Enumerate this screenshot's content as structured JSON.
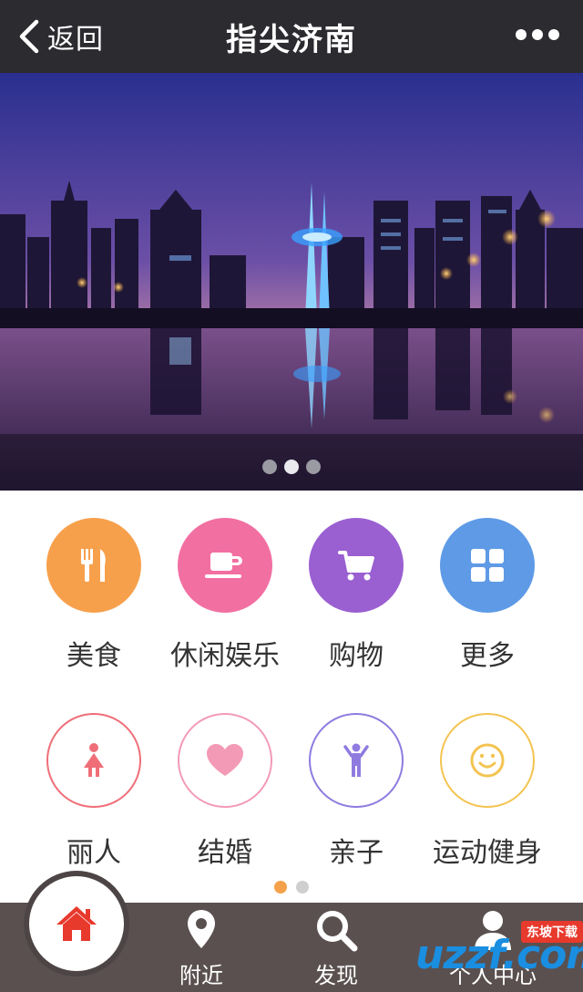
{
  "header": {
    "back_label": "返回",
    "title": "指尖济南"
  },
  "banner": {
    "dots_count": 3,
    "active_dot": 2
  },
  "categories_row1": [
    {
      "label": "美食",
      "color": "#f7a04c",
      "icon": "fork-knife-icon"
    },
    {
      "label": "休闲娱乐",
      "color": "#f26fa2",
      "icon": "coffee-cup-icon"
    },
    {
      "label": "购物",
      "color": "#9a5fd1",
      "icon": "shopping-cart-icon"
    },
    {
      "label": "更多",
      "color": "#5e9ae6",
      "icon": "grid-icon"
    }
  ],
  "categories_row2": [
    {
      "label": "丽人",
      "color": "#ef6e78",
      "icon": "woman-icon"
    },
    {
      "label": "结婚",
      "color": "#f39bb6",
      "icon": "heart-icon"
    },
    {
      "label": "亲子",
      "color": "#8f7be0",
      "icon": "child-icon"
    },
    {
      "label": "运动健身",
      "color": "#f3c451",
      "icon": "smiley-icon"
    }
  ],
  "page_dots": {
    "count": 2,
    "active": 1
  },
  "bottom_nav": {
    "home_color": "#e8392d",
    "nearby_label": "附近",
    "discover_label": "发现",
    "profile_label": "个人中心"
  },
  "watermark": {
    "logo": "uzzf.com",
    "tag": "东坡下载"
  }
}
